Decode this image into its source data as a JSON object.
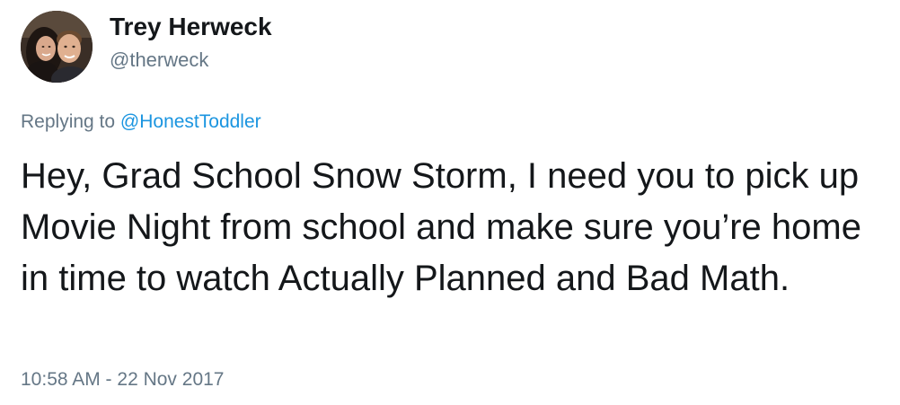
{
  "author": {
    "display_name": "Trey Herweck",
    "handle": "@therweck"
  },
  "reply": {
    "prefix": "Replying to",
    "mention": "@HonestToddler"
  },
  "tweet": {
    "text": "Hey, Grad School Snow Storm, I need you to pick up Movie Night from school and make sure you’re home in time to watch Actually Planned and Bad Math.",
    "timestamp": "10:58 AM - 22 Nov 2017"
  },
  "colors": {
    "text": "#14171a",
    "secondary": "#657786",
    "link": "#1b95e0"
  }
}
